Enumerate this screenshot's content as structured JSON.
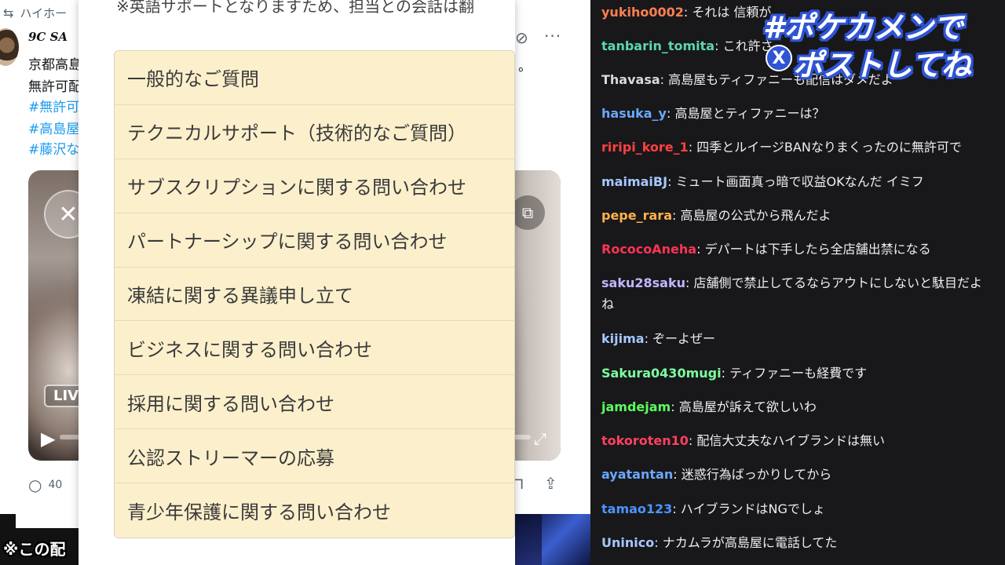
{
  "tweet": {
    "repost_label": "ハイホー",
    "author": "9C SA",
    "lines": [
      "京都高島",
      "無許可配"
    ],
    "hashtags": [
      "#無許可",
      "#高島屋",
      "#藤沢な"
    ],
    "right_text": "。",
    "live_label": "LIV",
    "reply_count": "40"
  },
  "modal": {
    "note": "※英語サポートとなりますため、担当との会話は翻",
    "categories": [
      "一般的なご質問",
      "テクニカルサポート（技術的なご質問）",
      "サブスクリプションに関する問い合わせ",
      "パートナーシップに関する問い合わせ",
      "凍結に関する異議申し立て",
      "ビジネスに関する問い合わせ",
      "採用に関する問い合わせ",
      "公認ストリーマーの応募",
      "青少年保護に関する問い合わせ"
    ]
  },
  "notice": "※この配",
  "overlay": {
    "line1": "#ポケカメンで",
    "line2": "ポストしてね",
    "x_label": "X"
  },
  "chat": {
    "messages": [
      {
        "user": "yukiho0002",
        "text": "それは 信頼が…",
        "color": "#ff7f50"
      },
      {
        "user": "tanbarin_tomita",
        "text": "これ許さ",
        "color": "#5cd6b2"
      },
      {
        "user": "Thavasa",
        "text": "高島屋もティファニーも配信はダメだよ",
        "color": "#d9d9d9"
      },
      {
        "user": "hasuka_y",
        "text": "高島屋とティファニーは？",
        "color": "#6aa8ff"
      },
      {
        "user": "riripi_kore_1",
        "text": "四季とルイージBANなりまくったのに無許可で",
        "color": "#ff4040"
      },
      {
        "user": "maimaiBJ",
        "text": "ミュート画面真っ暗で収益OKなんだ イミフ",
        "color": "#a6c8ff"
      },
      {
        "user": "pepe_rara",
        "text": "高島屋の公式から飛んだよ",
        "color": "#ffb34d"
      },
      {
        "user": "RococoAneha",
        "text": "デパートは下手したら全店舗出禁になる",
        "color": "#ff3355"
      },
      {
        "user": "saku28saku",
        "text": "店舗側で禁止してるならアウトにしないと駄目だよね",
        "color": "#c4b5ff"
      },
      {
        "user": "kijima",
        "text": "ぞーよぜー",
        "color": "#a6c8ff"
      },
      {
        "user": "Sakura0430mugi",
        "text": "ティファニーも経費です",
        "color": "#7dffa0"
      },
      {
        "user": "jamdejam",
        "text": "高島屋が訴えて欲しいわ",
        "color": "#5cff5c"
      },
      {
        "user": "tokoroten10",
        "text": "配信大丈夫なハイブランドは無い",
        "color": "#ff4060"
      },
      {
        "user": "ayatantan",
        "text": "迷惑行為ばっかりしてから",
        "color": "#6aa8ff"
      },
      {
        "user": "tamao123",
        "text": "ハイブランドはNGでしょ",
        "color": "#4d94ff"
      },
      {
        "user": "Uninico",
        "text": "ナカムラが高島屋に電話してた",
        "color": "#a6c8ff"
      }
    ]
  }
}
